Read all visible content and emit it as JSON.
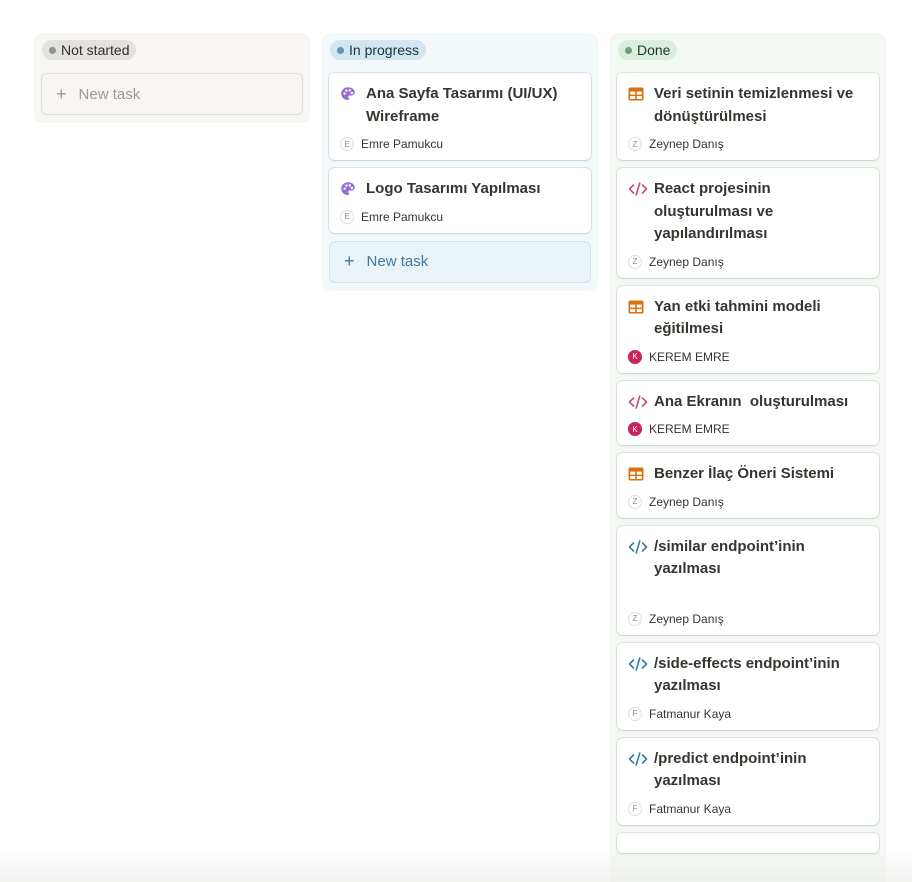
{
  "columns": {
    "not_started": {
      "label": "Not started",
      "new_task_label": "New task",
      "color": "#91918e"
    },
    "in_progress": {
      "label": "In progress",
      "new_task_label": "New task",
      "color": "#5b97bd",
      "cards": [
        {
          "title": "Ana Sayfa Tasarımı (UI/UX) Wireframe",
          "icon": "palette-icon",
          "assignee": "Emre Pamukcu",
          "initial": "E"
        },
        {
          "title": "Logo Tasarımı Yapılması",
          "icon": "palette-icon",
          "assignee": "Emre Pamukcu",
          "initial": "E"
        }
      ]
    },
    "done": {
      "label": "Done",
      "color": "#6c9b7d",
      "cards": [
        {
          "title": "Veri setinin temizlenmesi ve dönüştürülmesi",
          "icon": "table-icon",
          "assignee": "Zeynep Danış",
          "initial": "Z"
        },
        {
          "title": "React projesinin oluşturulması ve yapılandırılması",
          "icon": "code-icon",
          "assignee": "Zeynep Danış",
          "initial": "Z"
        },
        {
          "title": "Yan etki tahmini modeli eğitilmesi",
          "icon": "table-icon",
          "assignee": "KEREM EMRE",
          "initial": "K"
        },
        {
          "title": "Ana Ekranın  oluşturulması",
          "icon": "code-icon",
          "assignee": "KEREM EMRE",
          "initial": "K"
        },
        {
          "title": "Benzer İlaç Öneri Sistemi",
          "icon": "table-icon",
          "assignee": "Zeynep Danış",
          "initial": "Z"
        },
        {
          "title": "/similar endpoint’inin yazılması",
          "icon": "code-icon",
          "assignee": "Zeynep Danış",
          "initial": "Z"
        },
        {
          "title": "/side-effects endpoint’inin yazılması",
          "icon": "code-icon",
          "assignee": "Fatmanur Kaya",
          "initial": "F"
        },
        {
          "title": "/predict endpoint’inin yazılması",
          "icon": "code-icon",
          "assignee": "Fatmanur Kaya",
          "initial": "F"
        }
      ]
    }
  },
  "colors": {
    "palette_icon": "#9a6dd7",
    "table_icon": "#d9730d",
    "code_pink": "#c14c8a",
    "code_blue": "#337ea9",
    "avatar_red": "#c8245b"
  }
}
